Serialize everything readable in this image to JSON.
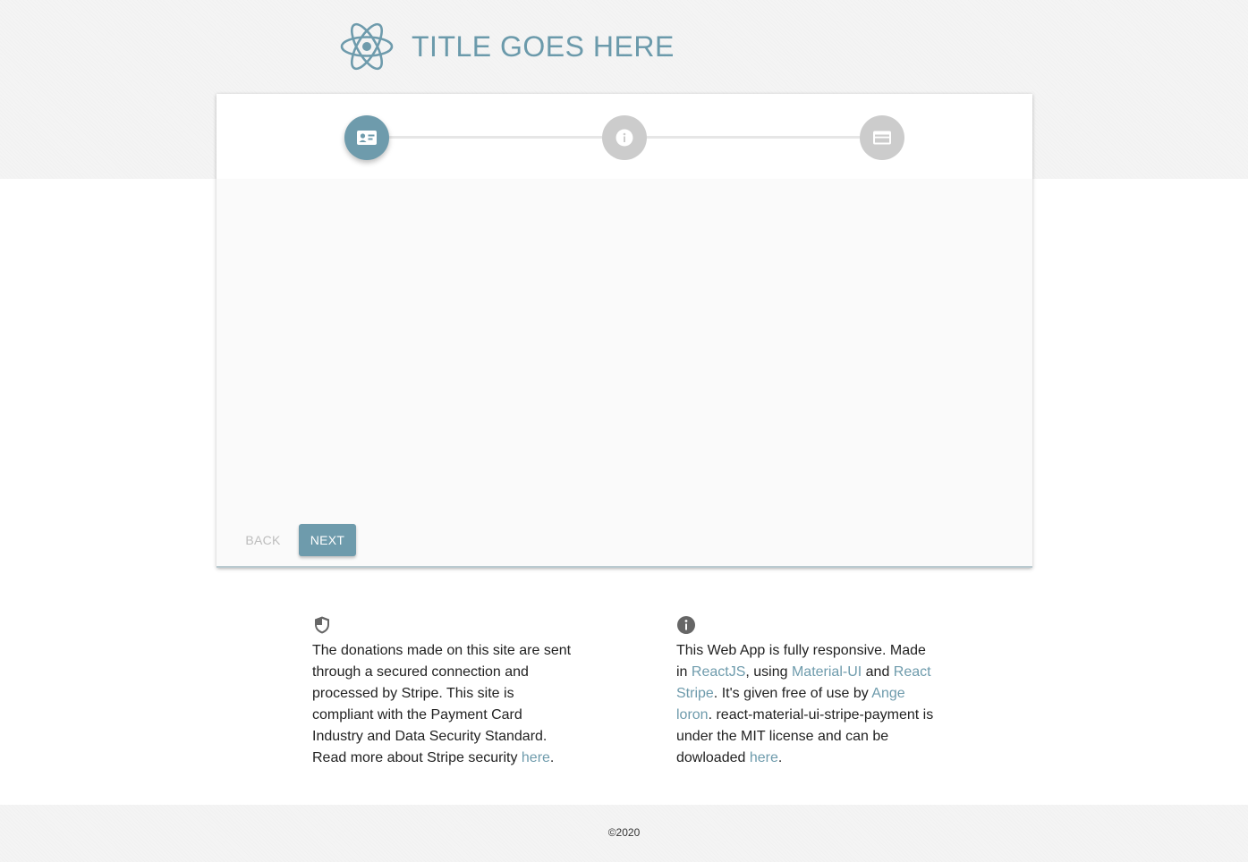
{
  "header": {
    "title": "TITLE GOES HERE",
    "logo_icon": "react-atom-icon"
  },
  "stepper": {
    "steps": [
      {
        "icon": "contact-card-icon",
        "state": "active"
      },
      {
        "icon": "info-icon",
        "state": "inactive"
      },
      {
        "icon": "credit-card-icon",
        "state": "inactive"
      }
    ]
  },
  "actions": {
    "back_label": "Back",
    "next_label": "Next"
  },
  "security_note": {
    "icon": "shield-icon",
    "text_before": "The donations made on this site are sent through a secured connection and processed by Stripe. This site is compliant with the Payment Card Industry and Data Security Standard. Read more about Stripe security ",
    "link_here": "here",
    "text_after": "."
  },
  "about_note": {
    "icon": "info-circle-icon",
    "part1": "This Web App is fully responsive. Made in ",
    "link_reactjs": "ReactJS",
    "part2": ", using ",
    "link_material_ui": "Material-UI",
    "part3": " and ",
    "link_react_stripe": "React Stripe",
    "part4": ". It's given free of use by ",
    "link_author": "Ange loron",
    "part5": ". react-material-ui-stripe-payment is under the MIT license and can be dowloaded ",
    "link_here": "here",
    "part6": "."
  },
  "footer": {
    "copyright": "©2020"
  },
  "colors": {
    "accent": "#6e9bac",
    "inactive_step": "#cccccc",
    "band_background": "#f4f4f4",
    "link": "#6e9bac"
  }
}
